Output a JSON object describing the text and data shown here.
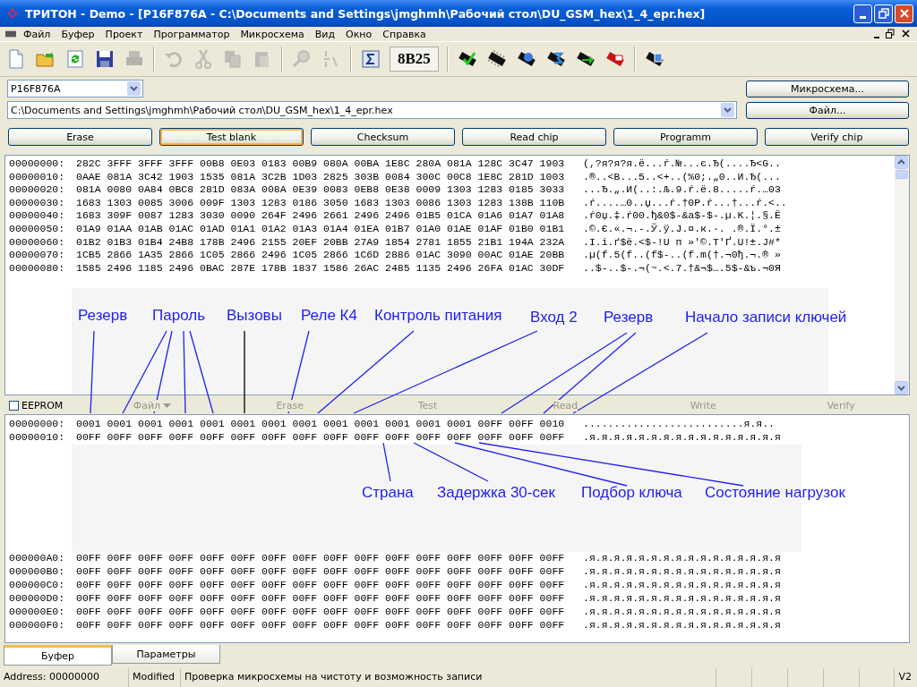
{
  "window": {
    "title": "ТРИТОН - Demo - [P16F876A - C:\\Documents and Settings\\jmghmh\\Рабочий стол\\DU_GSM_hex\\1_4_epr.hex]"
  },
  "menu": [
    "Файл",
    "Буфер",
    "Проект",
    "Программатор",
    "Микросхема",
    "Вид",
    "Окно",
    "Справка"
  ],
  "toolbar": [
    {
      "items": [
        {
          "kind": "button",
          "disabled": false
        },
        {
          "kind": "button",
          "disabled": false
        },
        {
          "kind": "button",
          "disabled": false
        },
        {
          "kind": "button",
          "disabled": false
        },
        {
          "kind": "button",
          "disabled": true
        }
      ]
    },
    {
      "items": [
        {
          "kind": "button",
          "disabled": true
        },
        {
          "kind": "button",
          "disabled": true
        },
        {
          "kind": "button",
          "disabled": true
        },
        {
          "kind": "button",
          "disabled": true
        }
      ]
    },
    {
      "items": [
        {
          "kind": "button",
          "disabled": true
        },
        {
          "kind": "button",
          "disabled": true
        }
      ]
    },
    {
      "items": [
        {
          "kind": "button",
          "disabled": false
        },
        {
          "kind": "display",
          "text": "8B25"
        }
      ]
    },
    {
      "items": [
        {
          "kind": "button",
          "disabled": false
        },
        {
          "kind": "button",
          "disabled": false
        },
        {
          "kind": "button",
          "disabled": false
        },
        {
          "kind": "button",
          "disabled": false
        },
        {
          "kind": "button",
          "disabled": false
        },
        {
          "kind": "button",
          "disabled": false
        }
      ]
    },
    {
      "items": [
        {
          "kind": "button",
          "disabled": false
        }
      ]
    }
  ],
  "chip_select": {
    "value": "P16F876A"
  },
  "chip_button": "Микросхема...",
  "file_path": {
    "value": "C:\\Documents and Settings\\jmghmh\\Рабочий стол\\DU_GSM_hex\\1_4_epr.hex"
  },
  "file_button": "Файл...",
  "actions": [
    {
      "label": "Erase",
      "focused": false
    },
    {
      "label": "Test blank",
      "focused": true
    },
    {
      "label": "Checksum",
      "focused": false
    },
    {
      "label": "Read chip",
      "focused": false
    },
    {
      "label": "Programm",
      "focused": false
    },
    {
      "label": "Verify chip",
      "focused": false
    }
  ],
  "program_buffer": {
    "rows": [
      {
        "address": "00000000:",
        "hex": "282C 3FFF 3FFF 3FFF 00B8 0E03 0183 00B9 080A 00BA 1E8C 280A 081A 128C 3C47 1903",
        "text": "(,?я?я?я.ё...ŕ.№...є.Ђ(....Ђ<G.."
      },
      {
        "address": "00000010:",
        "hex": "0AAE 081A 3C42 1903 1535 081A 3C2B 1D03 2825 303B 0084 300C 00C8 1E8C 281D 1003",
        "text": ".®..<B...5..<+..(%0;.„0..И.Ђ(..."
      },
      {
        "address": "00000020:",
        "hex": "081A 0080 0A84 0BC8 281D 083A 008A 0E39 0083 0EB8 0E38 0009 1303 1283 0185 3033",
        "text": "...Ђ.„.И(..:.Љ.9.ŕ.ё.8.....ŕ.…03"
      },
      {
        "address": "00000030:",
        "hex": "1683 1303 0085 3006 009F 1303 1283 0186 3050 1683 1303 0086 1303 1283 138B 110B",
        "text": ".ŕ....…0..џ...ŕ.†0P.ŕ...†...ŕ.<.."
      },
      {
        "address": "00000040:",
        "hex": "1683 309F 0087 1283 3030 0090 264F 2496 2661 2496 2496 01B5 01CA 01A6 01A7 01A8",
        "text": ".ŕ0џ.‡.ŕ00.ђ&0$-&a$-$-.µ.K.¦.§.Ё"
      },
      {
        "address": "00000050:",
        "hex": "01A9 01AA 01AB 01AC 01AD 01A1 01A2 01A3 01A4 01EA 01B7 01A0 01AE 01AF 01B0 01B1",
        "text": ".©.Є.«.¬.-.Ў.ў.J.¤.к.·. .®.Ї.°.±"
      },
      {
        "address": "00000060:",
        "hex": "01B2 01B3 01B4 24B8 178B 2496 2155 20EF 20BB 27A9 1854 2781 1855 21B1 194A 232A",
        "text": ".І.і.ґ$ё.<$-!U п »'©.T'Ґ.U!±.J#*"
      },
      {
        "address": "00000070:",
        "hex": "1CB5 2866 1A35 2866 1C05 2866 2496 1C05 2866 1C6D 2886 01AC 3090 00AC 01AE 20BB",
        "text": ".µ(f.5(f..(f$-..(f.m(†.¬0ђ.¬.® »"
      },
      {
        "address": "00000080:",
        "hex": "1585 2496 1185 2496 0BAC 287E 178B 1837 1586 26AC 2485 1135 2496 26FA 01AC 30DF",
        "text": "..$-..$-.¬(~.<.7.†&¬$….5$-&ъ.¬0Я"
      }
    ]
  },
  "eeprom_bar": {
    "label": "EEPROM",
    "checked": false,
    "columns": [
      {
        "label": "Файл",
        "kind": "dropdown",
        "disabled": true
      },
      {
        "label": "Erase",
        "kind": "button",
        "disabled": true
      },
      {
        "label": "Test",
        "kind": "button",
        "disabled": true
      },
      {
        "label": "Read",
        "kind": "button",
        "disabled": true
      },
      {
        "label": "Write",
        "kind": "button",
        "disabled": true
      },
      {
        "label": "Verify",
        "kind": "button",
        "disabled": true
      }
    ]
  },
  "eeprom_buffer": {
    "rows_top": [
      {
        "address": "00000000:",
        "hex": "0001 0001 0001 0001 0001 0001 0001 0001 0001 0001 0001 0001 0001 00FF 00FF 0010",
        "text": "..........................я.я.."
      },
      {
        "address": "00000010:",
        "hex": "00FF 00FF 00FF 00FF 00FF 00FF 00FF 00FF 00FF 00FF 00FF 00FF 00FF 00FF 00FF 00FF",
        "text": ".я.я.я.я.я.я.я.я.я.я.я.я.я.я.я.я"
      }
    ],
    "rows_bottom": [
      {
        "address": "000000A0:",
        "hex": "00FF 00FF 00FF 00FF 00FF 00FF 00FF 00FF 00FF 00FF 00FF 00FF 00FF 00FF 00FF 00FF",
        "text": ".я.я.я.я.я.я.я.я.я.я.я.я.я.я.я.я"
      },
      {
        "address": "000000B0:",
        "hex": "00FF 00FF 00FF 00FF 00FF 00FF 00FF 00FF 00FF 00FF 00FF 00FF 00FF 00FF 00FF 00FF",
        "text": ".я.я.я.я.я.я.я.я.я.я.я.я.я.я.я.я"
      },
      {
        "address": "000000C0:",
        "hex": "00FF 00FF 00FF 00FF 00FF 00FF 00FF 00FF 00FF 00FF 00FF 00FF 00FF 00FF 00FF 00FF",
        "text": ".я.я.я.я.я.я.я.я.я.я.я.я.я.я.я.я"
      },
      {
        "address": "000000D0:",
        "hex": "00FF 00FF 00FF 00FF 00FF 00FF 00FF 00FF 00FF 00FF 00FF 00FF 00FF 00FF 00FF 00FF",
        "text": ".я.я.я.я.я.я.я.я.я.я.я.я.я.я.я.я"
      },
      {
        "address": "000000E0:",
        "hex": "00FF 00FF 00FF 00FF 00FF 00FF 00FF 00FF 00FF 00FF 00FF 00FF 00FF 00FF 00FF 00FF",
        "text": ".я.я.я.я.я.я.я.я.я.я.я.я.я.я.я.я"
      },
      {
        "address": "000000F0:",
        "hex": "00FF 00FF 00FF 00FF 00FF 00FF 00FF 00FF 00FF 00FF 00FF 00FF 00FF 00FF 00FF 00FF",
        "text": ".я.я.я.я.я.я.я.я.я.я.я.я.я.я.я.я"
      }
    ]
  },
  "annotations": [
    {
      "text": "Резерв"
    },
    {
      "text": "Пароль"
    },
    {
      "text": "Вызовы"
    },
    {
      "text": "Реле К4"
    },
    {
      "text": "Контроль питания"
    },
    {
      "text": "Вход 2"
    },
    {
      "text": "Резерв"
    },
    {
      "text": "Начало записи ключей"
    },
    {
      "text": "Страна"
    },
    {
      "text": "Задержка 30-сек"
    },
    {
      "text": "Подбор ключа"
    },
    {
      "text": "Состояние нагрузок"
    }
  ],
  "tabs": [
    {
      "label": "Буфер",
      "selected": true
    },
    {
      "label": "Параметры",
      "selected": false
    }
  ],
  "status_bar": {
    "address": "Address: 00000000",
    "state": "Modified",
    "message": "Проверка микросхемы на чистоту и возможность записи",
    "version": "V2"
  }
}
